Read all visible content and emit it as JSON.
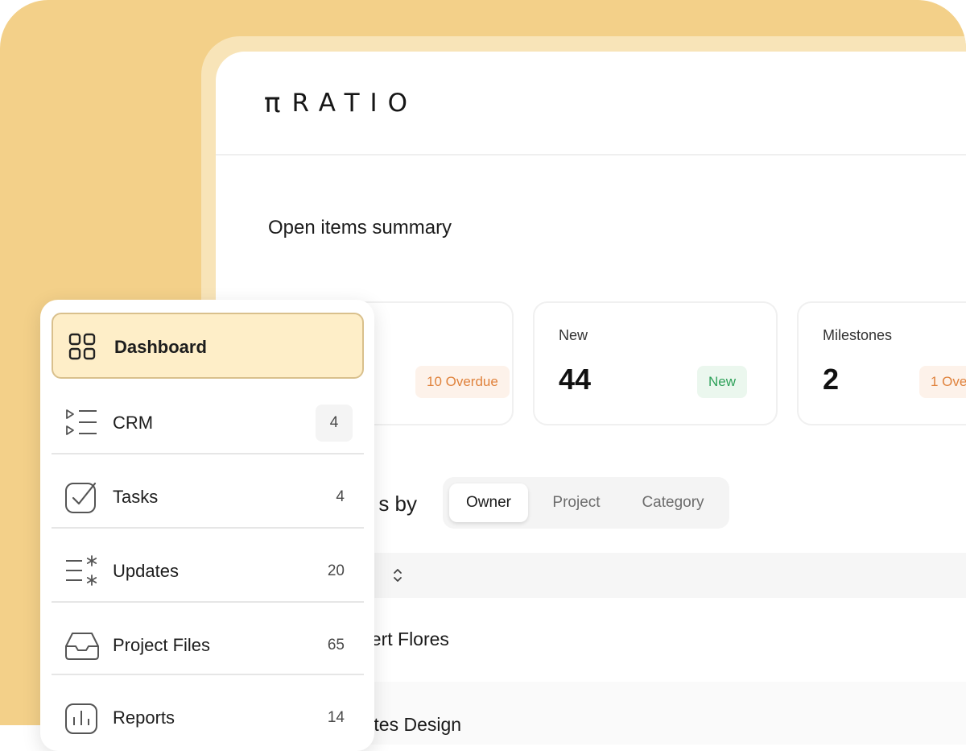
{
  "brand": {
    "logo_glyph": "π",
    "logo_text": "RATIO"
  },
  "summary": {
    "title": "Open items summary",
    "cards": [
      {
        "label": "",
        "value": "",
        "badge": "10 Overdue",
        "badge_type": "overdue"
      },
      {
        "label": "New",
        "value": "44",
        "badge": "New",
        "badge_type": "new"
      },
      {
        "label": "Milestones",
        "value": "2",
        "badge": "1 Ove",
        "badge_type": "overdue"
      }
    ]
  },
  "grouping": {
    "label": "s by",
    "tabs": [
      {
        "label": "Owner",
        "active": true
      },
      {
        "label": "Project",
        "active": false
      },
      {
        "label": "Category",
        "active": false
      }
    ]
  },
  "table": {
    "rows": [
      {
        "name": "bert Flores"
      },
      {
        "name": "ftes Design"
      }
    ]
  },
  "sidebar": {
    "items": [
      {
        "label": "Dashboard",
        "count": "",
        "icon": "grid-icon",
        "active": true
      },
      {
        "label": "CRM",
        "count": "4",
        "icon": "list-icon",
        "active": false
      },
      {
        "label": "Tasks",
        "count": "4",
        "icon": "checkbox-icon",
        "active": false
      },
      {
        "label": "Updates",
        "count": "20",
        "icon": "updates-icon",
        "active": false
      },
      {
        "label": "Project Files",
        "count": "65",
        "icon": "inbox-icon",
        "active": false
      },
      {
        "label": "Reports",
        "count": "14",
        "icon": "chart-icon",
        "active": false
      }
    ]
  },
  "colors": {
    "backdrop": "#f3d089",
    "active_nav_bg": "#feeec8",
    "overdue": "#e0833d",
    "new": "#2fa15a"
  }
}
